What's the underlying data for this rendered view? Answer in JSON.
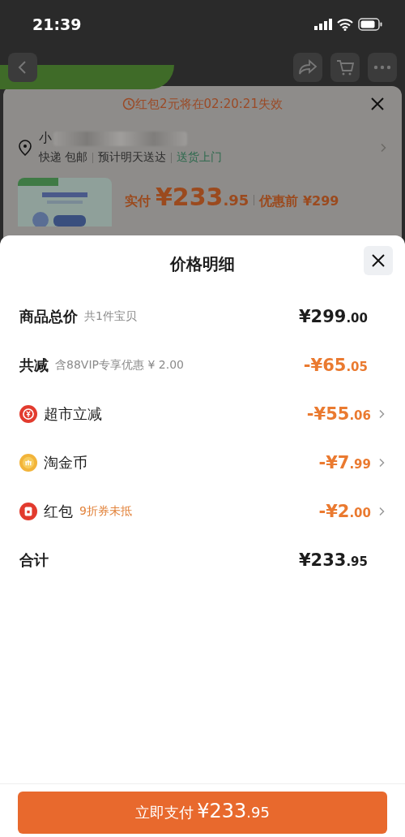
{
  "status_bar": {
    "time": "21:39"
  },
  "background_page": {
    "countdown": "红包2元将在02:20:21失效",
    "address_visible": "小",
    "delivery": [
      {
        "text": "快递 包邮",
        "kind": "plain"
      },
      {
        "text": "预计明天送达",
        "kind": "plain"
      },
      {
        "text": "送货上门",
        "kind": "highlight"
      }
    ],
    "paid_label": "实付",
    "paid_price": "¥233.95",
    "original_price": "优惠前 ¥299"
  },
  "sheet": {
    "title": "价格明细",
    "rows": [
      {
        "kind": "header",
        "label": "商品总价",
        "note": "共1件宝贝",
        "price": "¥299.00"
      },
      {
        "kind": "summary",
        "label": "共减",
        "note": "含88VIP专享优惠 ¥ 2.00",
        "price": "-¥65.05"
      },
      {
        "kind": "item",
        "label": "超市立减",
        "price": "-¥55.06"
      },
      {
        "kind": "item",
        "label": "淘金币",
        "price": "-¥7.99"
      },
      {
        "kind": "item",
        "label": "红包",
        "note": "9折券未抵",
        "price": "-¥2.00"
      },
      {
        "kind": "header",
        "label": "合计",
        "price": "¥233.95"
      }
    ]
  },
  "pay_button": {
    "label": "立即支付",
    "price": "¥233.95"
  }
}
